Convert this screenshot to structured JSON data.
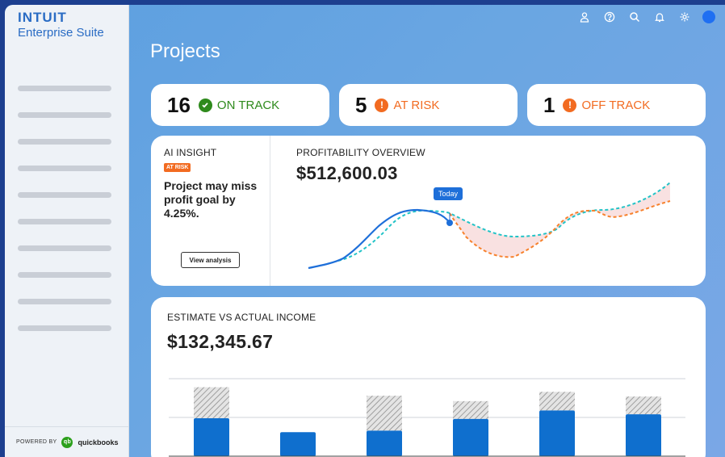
{
  "brand": {
    "logo": "INTUIT",
    "suite": "Enterprise Suite"
  },
  "sidebar": {
    "items": [
      "",
      "",
      "",
      "",
      "",
      "",
      "",
      "",
      "",
      ""
    ],
    "footer": {
      "powered_by": "POWERED BY",
      "qb_badge": "qb",
      "qb_word": "quickbooks"
    }
  },
  "topbar": {
    "icons": [
      "user-icon",
      "help-icon",
      "search-icon",
      "bell-icon",
      "settings-icon",
      "avatar"
    ]
  },
  "page": {
    "title": "Projects"
  },
  "status_cards": [
    {
      "count": "16",
      "label": "ON TRACK",
      "icon": "check-icon",
      "color": "#2e8a1c"
    },
    {
      "count": "5",
      "label": "AT RISK",
      "icon": "exclamation-icon",
      "color": "#f26b21"
    },
    {
      "count": "1",
      "label": "OFF TRACK",
      "icon": "exclamation-icon",
      "color": "#f26b21"
    }
  ],
  "insight": {
    "heading": "AI INSIGHT",
    "tag": "AT RISK",
    "text": "Project may miss profit goal by 4.25%.",
    "button": "View analysis"
  },
  "profitability": {
    "heading": "PROFITABILITY OVERVIEW",
    "amount": "$512,600.03",
    "today_label": "Today",
    "colors": {
      "actual": "#1e6fd9",
      "estimate": "#22c3c7",
      "projection": "#f7812c",
      "gap_fill": "#f8dcdc"
    }
  },
  "income": {
    "heading": "ESTIMATE VS ACTUAL INCOME",
    "amount": "$132,345.67"
  },
  "chart_data": {
    "type": "bar",
    "categories": [
      "",
      "",
      "",
      "",
      "",
      ""
    ],
    "series": [
      {
        "values": [
          49,
          31,
          33,
          48,
          59,
          54
        ]
      },
      {
        "values": [
          89,
          31,
          78,
          71,
          83,
          77
        ]
      }
    ],
    "ylim": [
      0,
      100
    ],
    "grid": true,
    "colors": {
      "actual": "#0f6fce",
      "estimate_hatch": "#9a9a9a"
    }
  }
}
